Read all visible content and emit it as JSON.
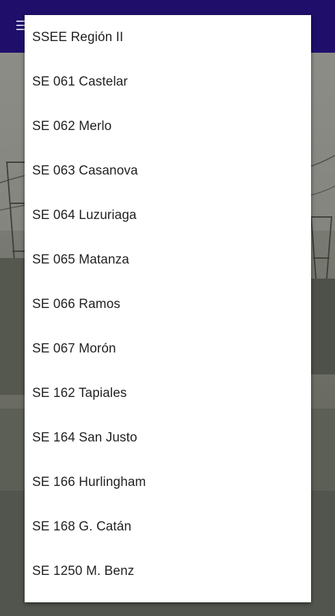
{
  "app_bar": {
    "menu_icon": "hamburger-menu-icon",
    "background_color": "#1f0f6b"
  },
  "dropdown": {
    "items": [
      {
        "label": "SSEE Región II"
      },
      {
        "label": "SE 061 Castelar"
      },
      {
        "label": "SE 062 Merlo"
      },
      {
        "label": "SE 063 Casanova"
      },
      {
        "label": "SE 064 Luzuriaga"
      },
      {
        "label": "SE 065 Matanza"
      },
      {
        "label": "SE 066 Ramos"
      },
      {
        "label": "SE 067 Morón"
      },
      {
        "label": "SE 162 Tapiales"
      },
      {
        "label": "SE 164 San Justo"
      },
      {
        "label": "SE 166 Hurlingham"
      },
      {
        "label": "SE 168 G. Catán"
      },
      {
        "label": "SE 1250 M. Benz"
      }
    ]
  }
}
